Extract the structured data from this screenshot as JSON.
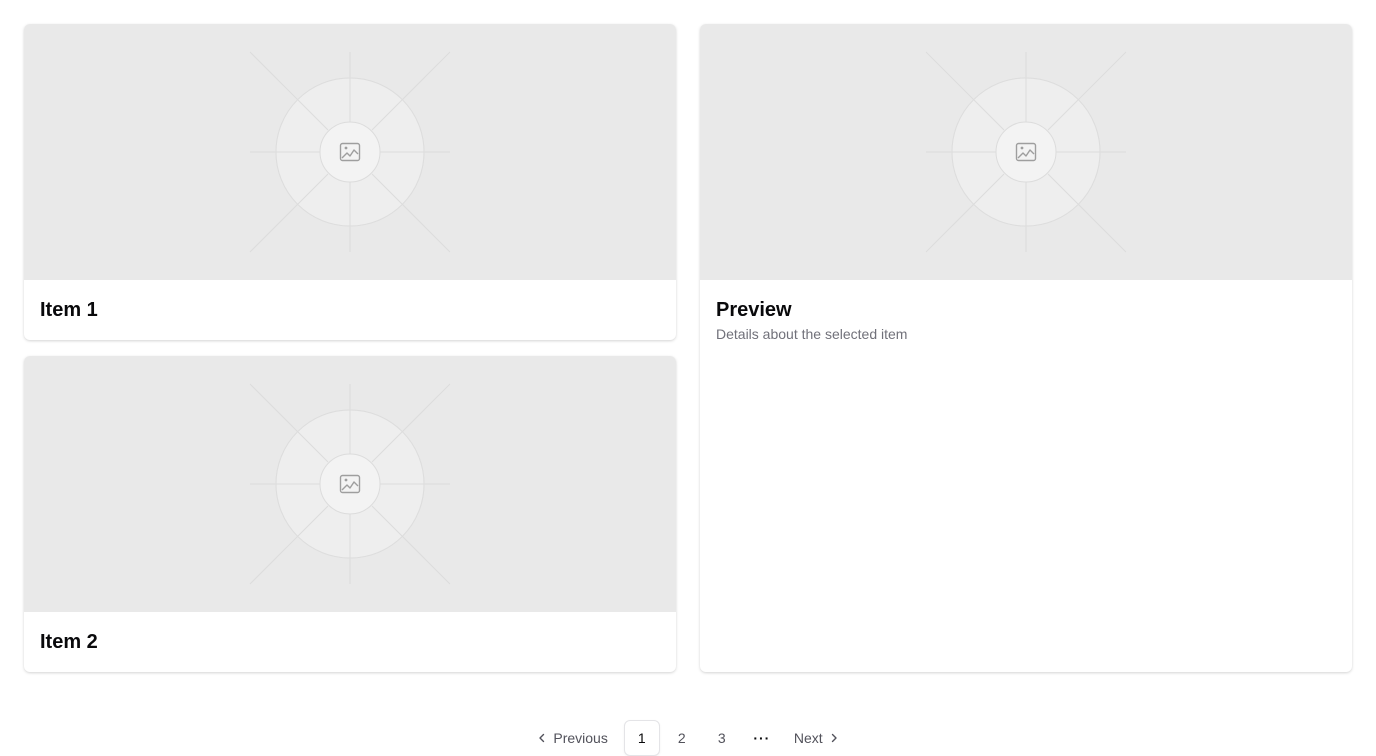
{
  "cards": [
    {
      "title": "Item 1",
      "image_icon": "image-placeholder-icon"
    },
    {
      "title": "Item 2",
      "image_icon": "image-placeholder-icon"
    }
  ],
  "preview": {
    "title": "Preview",
    "description": "Details about the selected item",
    "image_icon": "image-placeholder-icon"
  },
  "pagination": {
    "previous_label": "Previous",
    "next_label": "Next",
    "pages": [
      "1",
      "2",
      "3"
    ],
    "ellipsis": "···",
    "current_page": "1"
  },
  "colors": {
    "placeholder_bg": "#e9e9e9",
    "title_text": "#09090b",
    "muted_text": "#71717a"
  }
}
